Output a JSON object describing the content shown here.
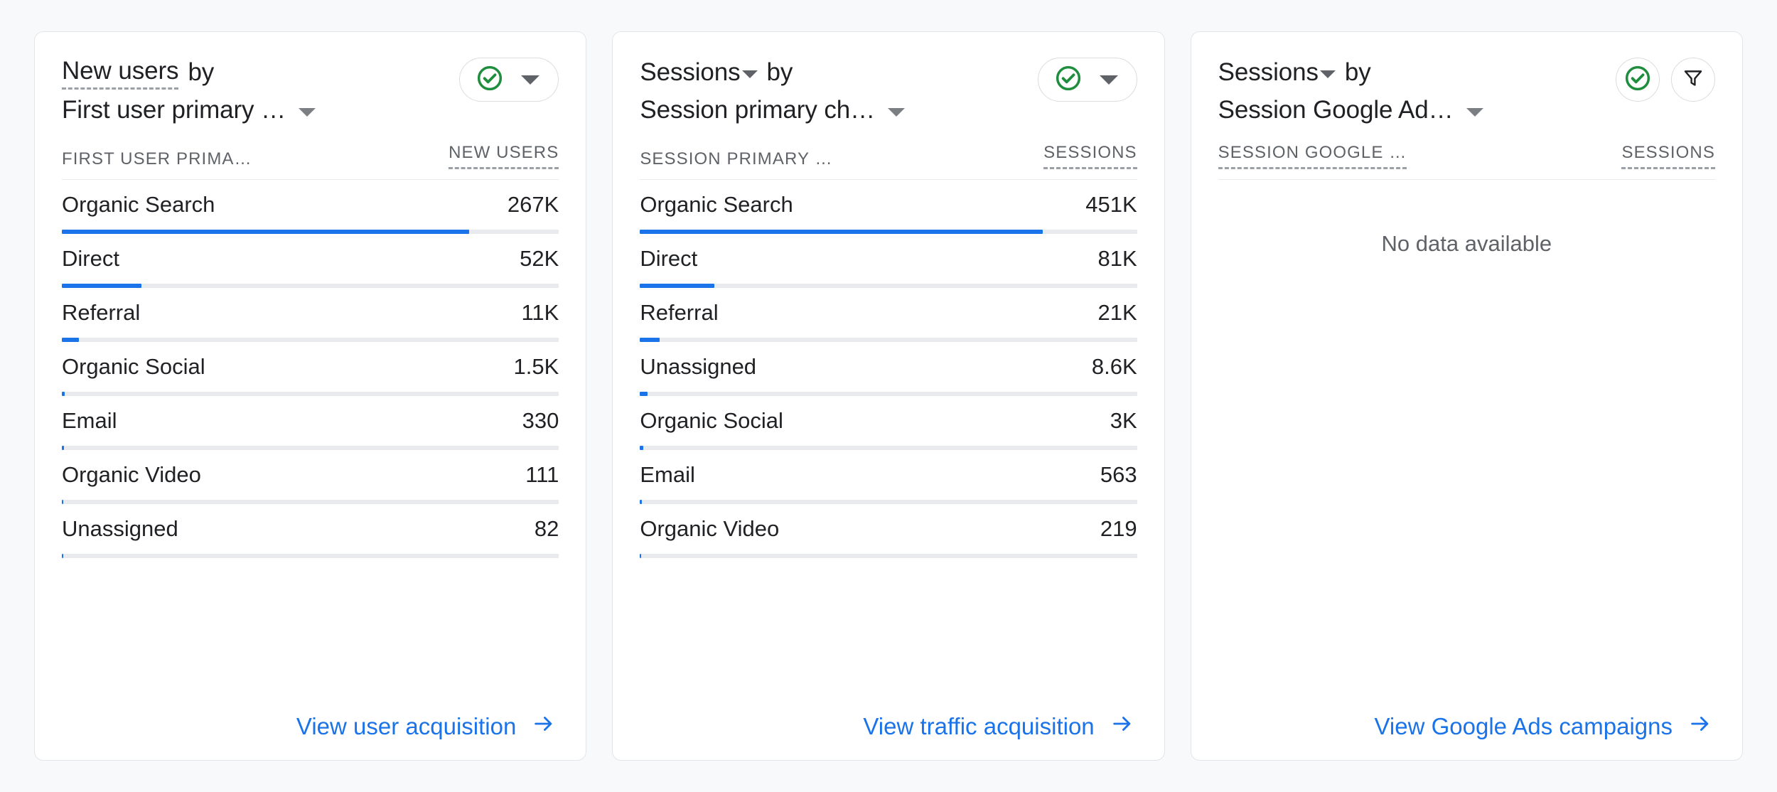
{
  "theme": {
    "page_bg": "#f8f9fa",
    "card_bg": "#ffffff",
    "accent_blue": "#1a73e8",
    "check_green": "#1e8e3e",
    "text_primary": "#202124",
    "text_secondary": "#5f6368",
    "track_gray": "#e8eaed"
  },
  "cards": [
    {
      "id": "user-acquisition",
      "title": {
        "metric": "New users",
        "metric_has_caret": false,
        "metric_dashed": true,
        "connector": "by",
        "dimension": "First user primary …"
      },
      "controls": {
        "type": "pill",
        "status_icon": "check-circle-icon",
        "dropdown_icon": "chevron-down-icon"
      },
      "columns": {
        "dimension": "FIRST USER PRIMA…",
        "metric": "NEW USERS"
      },
      "rows": [
        {
          "label": "Organic Search",
          "value": "267K",
          "raw": 267000,
          "bar_pct": 82
        },
        {
          "label": "Direct",
          "value": "52K",
          "raw": 52000,
          "bar_pct": 16
        },
        {
          "label": "Referral",
          "value": "11K",
          "raw": 11000,
          "bar_pct": 3.4
        },
        {
          "label": "Organic Social",
          "value": "1.5K",
          "raw": 1500,
          "bar_pct": 0.6
        },
        {
          "label": "Email",
          "value": "330",
          "raw": 330,
          "bar_pct": 0.4
        },
        {
          "label": "Organic Video",
          "value": "111",
          "raw": 111,
          "bar_pct": 0.35
        },
        {
          "label": "Unassigned",
          "value": "82",
          "raw": 82,
          "bar_pct": 0.3
        }
      ],
      "empty_text": null,
      "footer": {
        "label": "View user acquisition",
        "icon": "arrow-right-icon"
      }
    },
    {
      "id": "traffic-acquisition",
      "title": {
        "metric": "Sessions",
        "metric_has_caret": true,
        "metric_dashed": false,
        "connector": "by",
        "dimension": "Session primary ch…"
      },
      "controls": {
        "type": "pill",
        "status_icon": "check-circle-icon",
        "dropdown_icon": "chevron-down-icon"
      },
      "columns": {
        "dimension": "SESSION PRIMARY …",
        "metric": "SESSIONS"
      },
      "rows": [
        {
          "label": "Organic Search",
          "value": "451K",
          "raw": 451000,
          "bar_pct": 81
        },
        {
          "label": "Direct",
          "value": "81K",
          "raw": 81000,
          "bar_pct": 15
        },
        {
          "label": "Referral",
          "value": "21K",
          "raw": 21000,
          "bar_pct": 4
        },
        {
          "label": "Unassigned",
          "value": "8.6K",
          "raw": 8600,
          "bar_pct": 1.5
        },
        {
          "label": "Organic Social",
          "value": "3K",
          "raw": 3000,
          "bar_pct": 0.6
        },
        {
          "label": "Email",
          "value": "563",
          "raw": 563,
          "bar_pct": 0.4
        },
        {
          "label": "Organic Video",
          "value": "219",
          "raw": 219,
          "bar_pct": 0.3
        }
      ],
      "empty_text": null,
      "footer": {
        "label": "View traffic acquisition",
        "icon": "arrow-right-icon"
      }
    },
    {
      "id": "google-ads-campaigns",
      "title": {
        "metric": "Sessions",
        "metric_has_caret": true,
        "metric_dashed": false,
        "connector": "by",
        "dimension": "Session Google Ad…"
      },
      "controls": {
        "type": "buttons",
        "status_icon": "check-circle-icon",
        "filter_icon": "filter-funnel-icon"
      },
      "columns": {
        "dimension": "SESSION GOOGLE …",
        "metric": "SESSIONS"
      },
      "rows": [],
      "empty_text": "No data available",
      "footer": {
        "label": "View Google Ads campaigns",
        "icon": "arrow-right-icon"
      }
    }
  ]
}
